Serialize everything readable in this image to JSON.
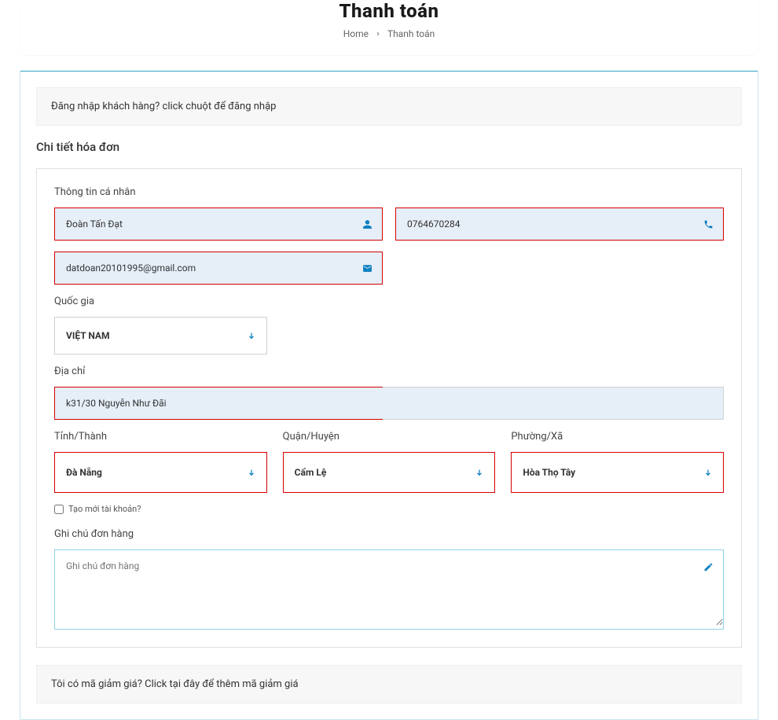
{
  "header": {
    "title": "Thanh toán",
    "breadcrumb_home": "Home",
    "breadcrumb_current": "Thanh toán"
  },
  "login_notice": {
    "prefix": "Đăng nhập khách hàng? ",
    "link": "click chuột để đăng nhập"
  },
  "billing": {
    "section_title": "Chi tiết hóa đơn",
    "personal_info_label": "Thông tin cá nhân",
    "name_value": "Đoàn Tấn Đạt",
    "phone_value": "0764670284",
    "email_value": "datdoan20101995@gmail.com",
    "country_label": "Quốc gia",
    "country_value": "VIỆT NAM",
    "address_label": "Địa chỉ",
    "address_value": "k31/30 Nguyễn Như Đãi",
    "province_label": "Tỉnh/Thành",
    "province_value": "Đà Nẵng",
    "district_label": "Quận/Huyện",
    "district_value": "Cẩm Lệ",
    "ward_label": "Phường/Xã",
    "ward_value": "Hòa Thọ Tây",
    "create_account_label": "Tạo mới tài khoản?",
    "notes_label": "Ghi chú đơn hàng",
    "notes_placeholder": "Ghi chú đơn hàng"
  },
  "coupon": {
    "prefix": "Tôi có mã giảm giá? ",
    "link": "Click tại đây để thêm mã giảm giá"
  }
}
